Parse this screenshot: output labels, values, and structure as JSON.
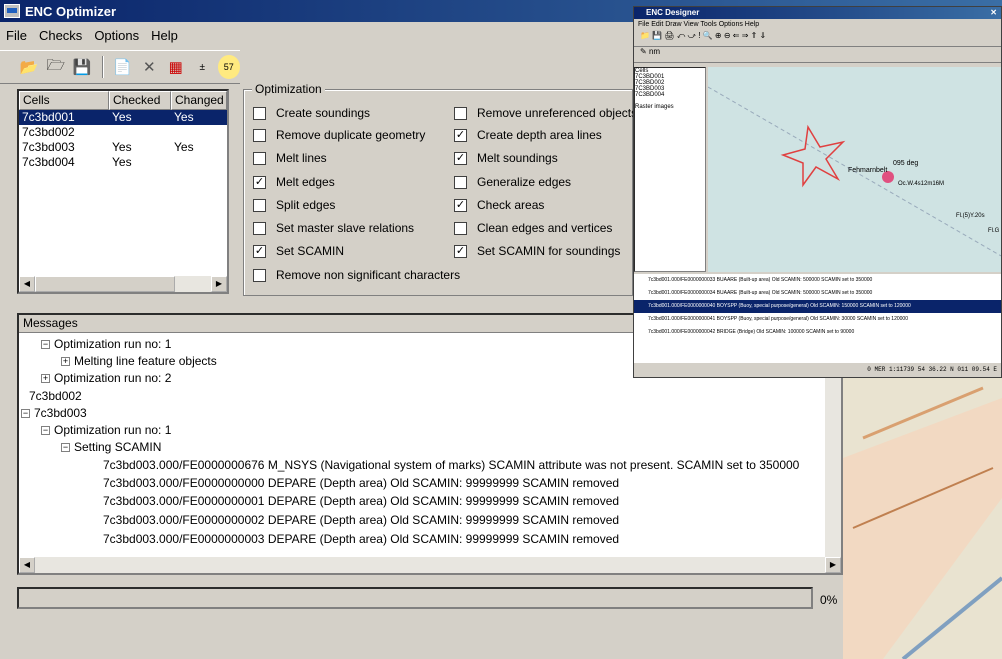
{
  "window": {
    "title": "ENC Optimizer"
  },
  "menu": [
    {
      "label": "File"
    },
    {
      "label": "Checks"
    },
    {
      "label": "Options"
    },
    {
      "label": "Help"
    }
  ],
  "toolbar": {
    "icons": [
      "open-folder-icon",
      "open-folder-alt-icon",
      "save-icon",
      "report-icon",
      "delete-icon",
      "grid-icon",
      "plus-one-icon",
      "lightbulb-icon"
    ],
    "badge": "57"
  },
  "cells": {
    "headers": [
      "Cells",
      "Checked",
      "Changed"
    ],
    "rows": [
      {
        "name": "7c3bd001",
        "checked": "Yes",
        "changed": "Yes"
      },
      {
        "name": "7c3bd002",
        "checked": "",
        "changed": ""
      },
      {
        "name": "7c3bd003",
        "checked": "Yes",
        "changed": "Yes"
      },
      {
        "name": "7c3bd004",
        "checked": "Yes",
        "changed": ""
      }
    ]
  },
  "optimization": {
    "legend": "Optimization",
    "left": [
      {
        "label": "Create soundings",
        "checked": false
      },
      {
        "label": "Remove duplicate geometry",
        "checked": false
      },
      {
        "label": "Melt lines",
        "checked": false
      },
      {
        "label": "Melt edges",
        "checked": true
      },
      {
        "label": "Split edges",
        "checked": false
      },
      {
        "label": "Set master slave relations",
        "checked": false
      },
      {
        "label": "Set SCAMIN",
        "checked": true
      },
      {
        "label": "Remove non significant characters",
        "checked": false
      }
    ],
    "right": [
      {
        "label": "Remove unreferenced objects",
        "checked": false
      },
      {
        "label": "Create depth area lines",
        "checked": true
      },
      {
        "label": "Melt soundings",
        "checked": true
      },
      {
        "label": "Generalize edges",
        "checked": false
      },
      {
        "label": "Check areas",
        "checked": true
      },
      {
        "label": "Clean edges and vertices",
        "checked": false
      },
      {
        "label": "Set SCAMIN for soundings",
        "checked": true
      }
    ]
  },
  "messages": {
    "title": "Messages",
    "lines": [
      "Optimization run no: 1",
      "Melting line feature objects",
      "Optimization run no: 2",
      "7c3bd002",
      "7c3bd003",
      "Optimization run no: 1",
      "Setting SCAMIN",
      "7c3bd003.000/FE0000000676 M_NSYS (Navigational system of marks) SCAMIN attribute was not present. SCAMIN set to 350000",
      "7c3bd003.000/FE0000000000 DEPARE (Depth area) Old SCAMIN: 99999999 SCAMIN removed",
      "7c3bd003.000/FE0000000001 DEPARE (Depth area) Old SCAMIN: 99999999 SCAMIN removed",
      "7c3bd003.000/FE0000000002 DEPARE (Depth area) Old SCAMIN: 99999999 SCAMIN removed",
      "7c3bd003.000/FE0000000003 DEPARE (Depth area) Old SCAMIN: 99999999 SCAMIN removed"
    ]
  },
  "progress": {
    "value": 0,
    "label": "0%"
  },
  "designer": {
    "title": "ENC Designer",
    "menu": [
      "File",
      "Edit",
      "Draw",
      "View",
      "Tools",
      "Options",
      "Help"
    ],
    "unit": "nm",
    "cells": [
      "Cells",
      "7C3BD001",
      "7C3BD002",
      "7C3BD003",
      "7C3BD004"
    ],
    "raster": "Raster images",
    "map_labels": [
      "Fehmarnbelt",
      "095 deg",
      "Oc.W.4s12m16M",
      "Fl.(5)Y.20s",
      "Fl.G"
    ],
    "log": [
      "7c3bd001.000/FE0000000033 BUAARE (Built-up area) Old SCAMIN: 500000 SCAMIN set to 350000",
      "7c3bd001.000/FE0000000034 BUAARE (Built-up area) Old SCAMIN: 500000 SCAMIN set to 350000",
      "7c3bd001.000/FE0000000040 BOYSPP (Buoy, special purpose/general) Old SCAMIN: 150000 SCAMIN set to 120000",
      "7c3bd001.000/FE0000000041 BOYSPP (Buoy, special purpose/general) Old SCAMIN: 30000 SCAMIN set to 120000",
      "7c3bd001.000/FE0000000042 BRIDGE (Bridge) Old SCAMIN: 100000 SCAMIN set to 90000"
    ],
    "status": [
      "0",
      "MER",
      "1:11739",
      "54 36.22 N",
      "011 09.54 E"
    ]
  }
}
